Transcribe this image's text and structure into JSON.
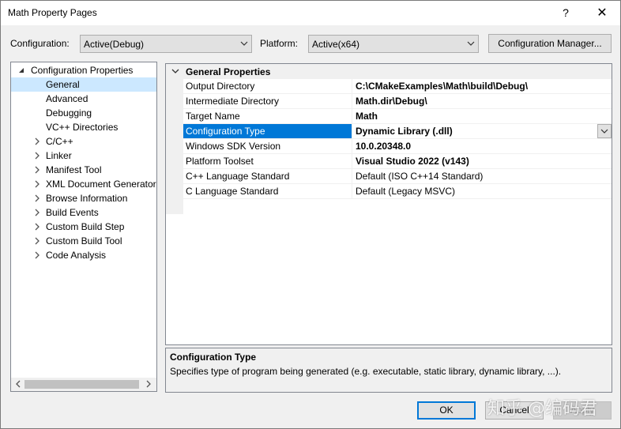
{
  "window": {
    "title": "Math Property Pages",
    "help_glyph": "?",
    "close_glyph": "✕"
  },
  "toolbar": {
    "configuration_label": "Configuration:",
    "configuration_value": "Active(Debug)",
    "platform_label": "Platform:",
    "platform_value": "Active(x64)",
    "config_manager_label": "Configuration Manager..."
  },
  "tree": {
    "root": "Configuration Properties",
    "items": [
      {
        "label": "General",
        "selected": true,
        "expandable": false
      },
      {
        "label": "Advanced",
        "expandable": false
      },
      {
        "label": "Debugging",
        "expandable": false
      },
      {
        "label": "VC++ Directories",
        "expandable": false
      },
      {
        "label": "C/C++",
        "expandable": true
      },
      {
        "label": "Linker",
        "expandable": true
      },
      {
        "label": "Manifest Tool",
        "expandable": true
      },
      {
        "label": "XML Document Generator",
        "expandable": true
      },
      {
        "label": "Browse Information",
        "expandable": true
      },
      {
        "label": "Build Events",
        "expandable": true
      },
      {
        "label": "Custom Build Step",
        "expandable": true
      },
      {
        "label": "Custom Build Tool",
        "expandable": true
      },
      {
        "label": "Code Analysis",
        "expandable": true
      }
    ]
  },
  "properties": {
    "section": "General Properties",
    "rows": [
      {
        "name": "Output Directory",
        "value": "C:\\CMakeExamples\\Math\\build\\Debug\\",
        "bold": true
      },
      {
        "name": "Intermediate Directory",
        "value": "Math.dir\\Debug\\",
        "bold": true
      },
      {
        "name": "Target Name",
        "value": "Math",
        "bold": true
      },
      {
        "name": "Configuration Type",
        "value": "Dynamic Library (.dll)",
        "bold": true,
        "selected": true
      },
      {
        "name": "Windows SDK Version",
        "value": "10.0.20348.0",
        "bold": true
      },
      {
        "name": "Platform Toolset",
        "value": "Visual Studio 2022 (v143)",
        "bold": true
      },
      {
        "name": "C++ Language Standard",
        "value": "Default (ISO C++14 Standard)",
        "bold": false
      },
      {
        "name": "C Language Standard",
        "value": "Default (Legacy MSVC)",
        "bold": false
      }
    ]
  },
  "description": {
    "title": "Configuration Type",
    "text": "Specifies type of program being generated (e.g. executable, static library, dynamic library, ...)."
  },
  "buttons": {
    "ok": "OK",
    "cancel": "Cancel",
    "apply": "Apply"
  },
  "watermark": "知乎 @编码君",
  "colors": {
    "selection": "#0078d7",
    "tree_selection": "#cce8ff",
    "focus_border": "#0078d7"
  }
}
